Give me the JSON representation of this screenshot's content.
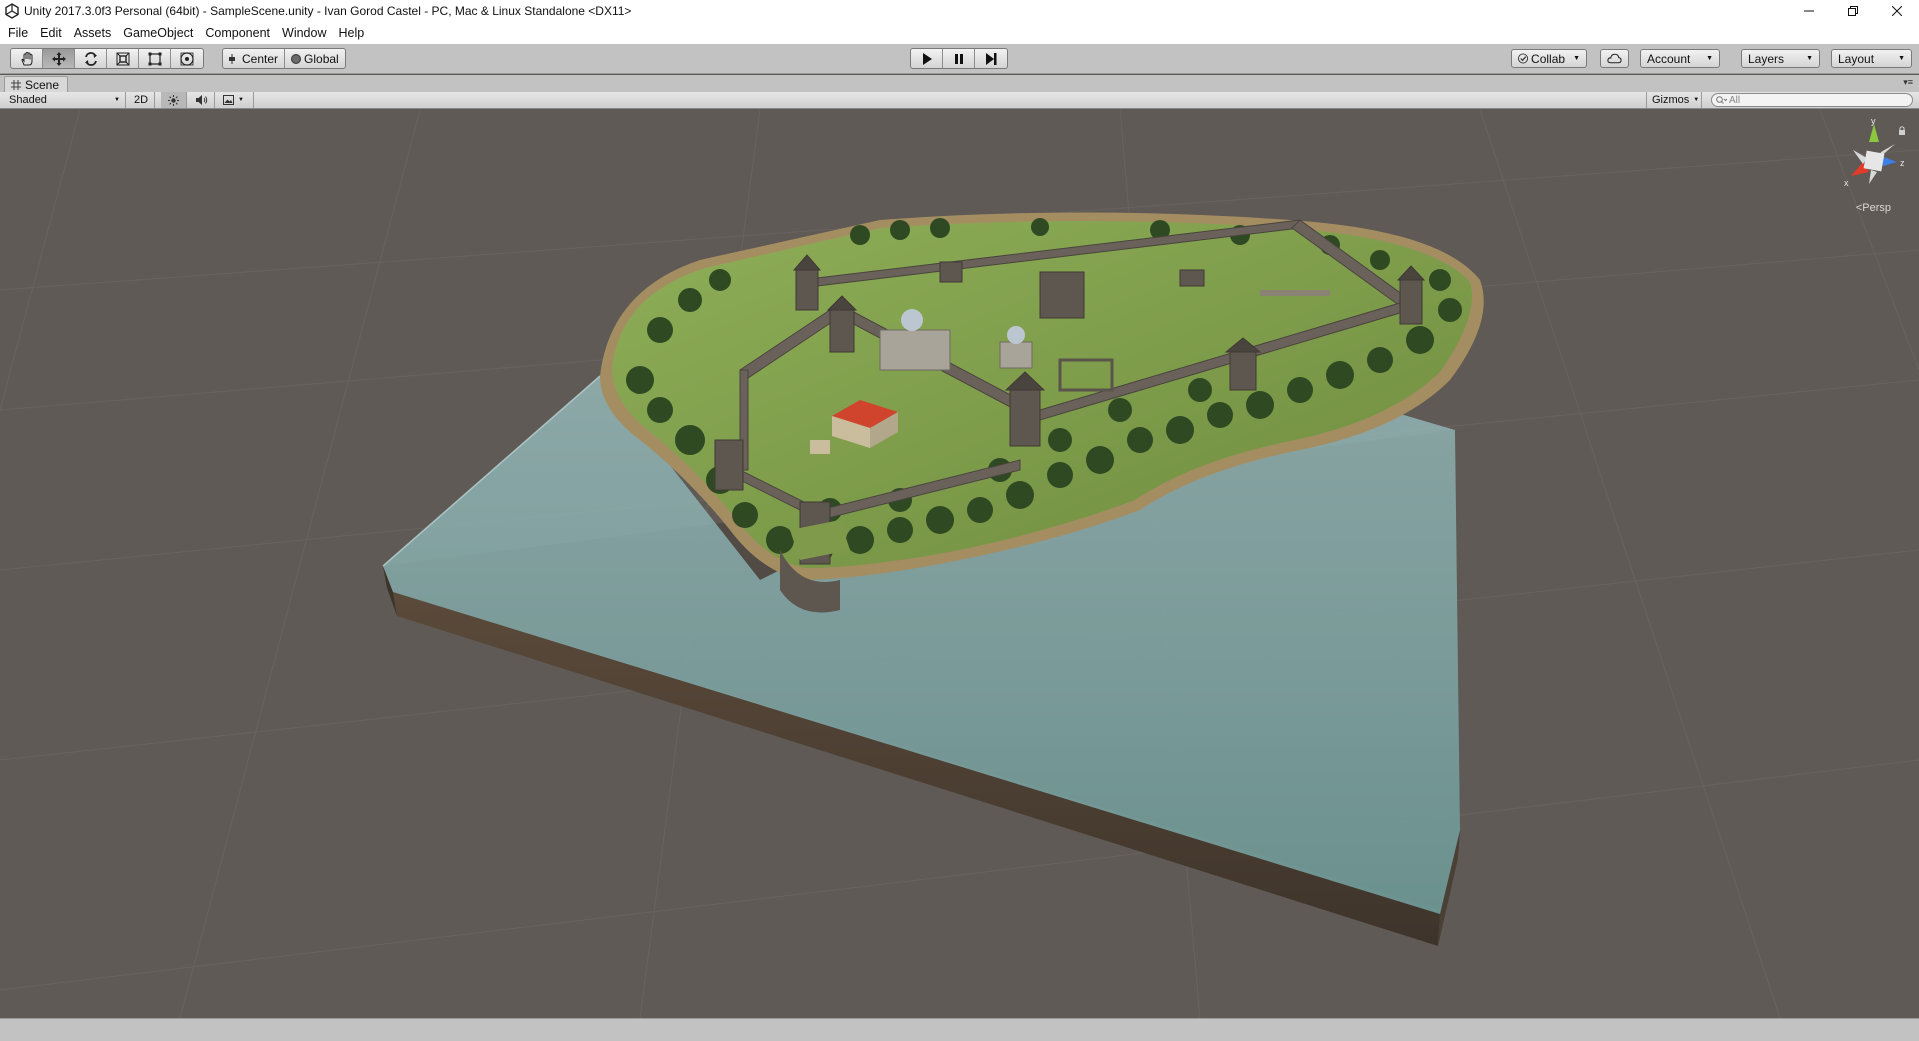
{
  "window": {
    "title": "Unity 2017.3.0f3 Personal (64bit) - SampleScene.unity - Ivan Gorod Castel - PC, Mac & Linux Standalone <DX11>"
  },
  "menu": [
    "File",
    "Edit",
    "Assets",
    "GameObject",
    "Component",
    "Window",
    "Help"
  ],
  "toolbar": {
    "tools": [
      "hand-tool",
      "move-tool",
      "rotate-tool",
      "scale-tool",
      "rect-tool",
      "transform-tool"
    ],
    "active_tool": "move-tool",
    "pivot_mode": "Center",
    "pivot_rotation": "Global",
    "collab_label": "Collab",
    "account_label": "Account",
    "layers_label": "Layers",
    "layout_label": "Layout"
  },
  "scene_tab": {
    "label": "Scene"
  },
  "scene_toolbar": {
    "draw_mode": "Shaded",
    "mode_2d_label": "2D",
    "gizmos_label": "Gizmos",
    "search_placeholder": "All"
  },
  "gizmo": {
    "y_label": "y",
    "z_label": "z",
    "x_label": "x",
    "projection_label": "Persp"
  },
  "colors": {
    "viewport_bg": "#5f5a55",
    "grass": "#7f9a4a",
    "water": "#7fb0b0",
    "stone": "#6a625a",
    "roof_red": "#d0442e",
    "gizmo_y": "#8dc63f",
    "gizmo_z": "#3d7fe6",
    "gizmo_x": "#e03c2a"
  }
}
